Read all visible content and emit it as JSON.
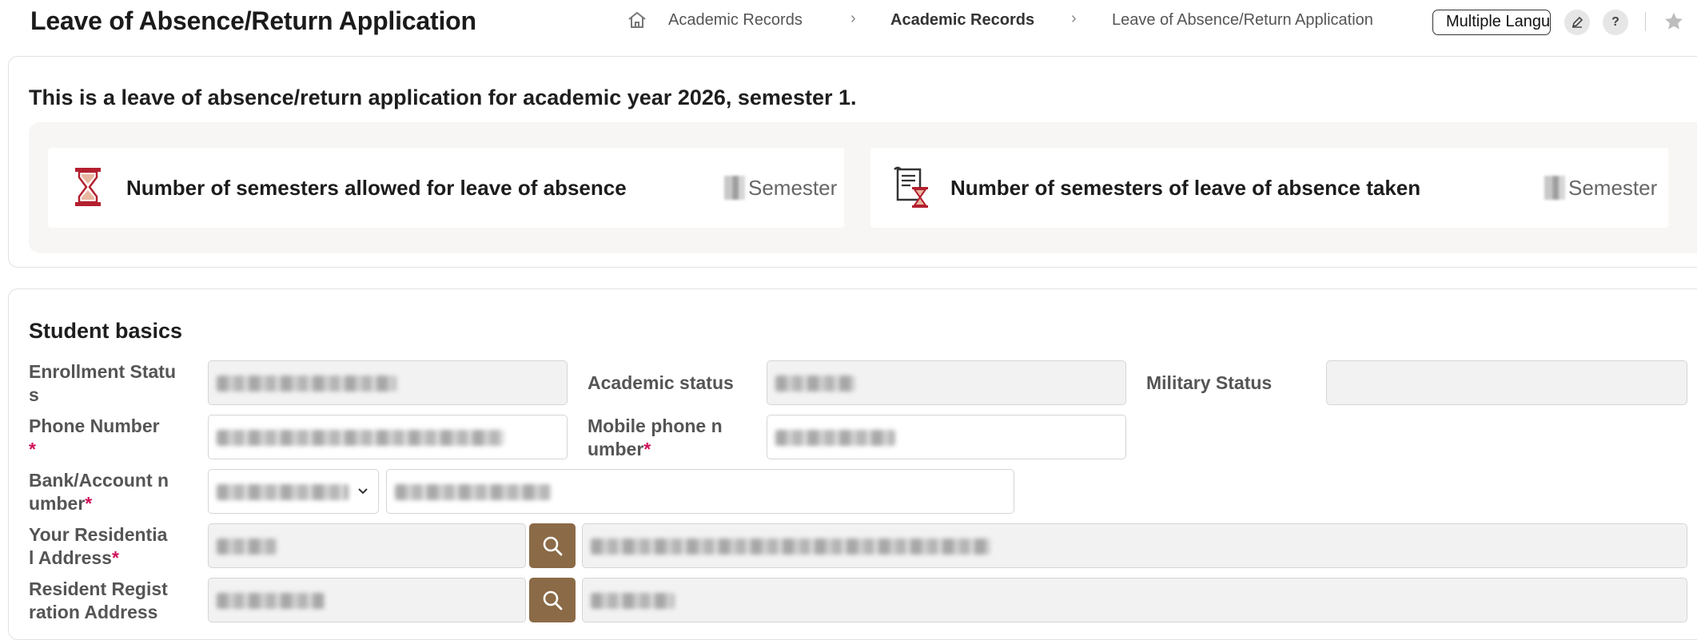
{
  "header": {
    "title": "Leave of Absence/Return Application",
    "breadcrumb": [
      "Academic Records",
      "Academic Records",
      "Leave of Absence/Return Application"
    ],
    "language_button": "Multiple Languages",
    "help_label": "?"
  },
  "notice": {
    "intro": "This is a leave of absence/return application for academic year 2026, semester 1."
  },
  "stats": {
    "allowed_label": "Number of semesters allowed for leave of absence",
    "allowed_unit": "Semester",
    "taken_label": "Number of semesters of leave of absence taken",
    "taken_unit": "Semester"
  },
  "student_basics": {
    "title": "Student basics",
    "enrollment_status_label": "Enrollment Statu\ns",
    "academic_status_label": "Academic status",
    "military_status_label": "Military Status",
    "phone_label": "Phone Number",
    "mobile_label": "Mobile phone n\number",
    "bank_label": "Bank/Account n\number",
    "residential_label": "Your Residentia\nl Address",
    "registration_label": "Resident Regist\nration Address",
    "required_mark": "*"
  },
  "colors": {
    "accent_brown": "#8b6a47",
    "required_red": "#d0115a",
    "icon_red": "#b3202f"
  },
  "icons": [
    "home-icon",
    "edit-icon",
    "help-icon",
    "star-icon",
    "hourglass-icon",
    "scroll-hourglass-icon",
    "search-icon",
    "chevron-down-icon"
  ]
}
